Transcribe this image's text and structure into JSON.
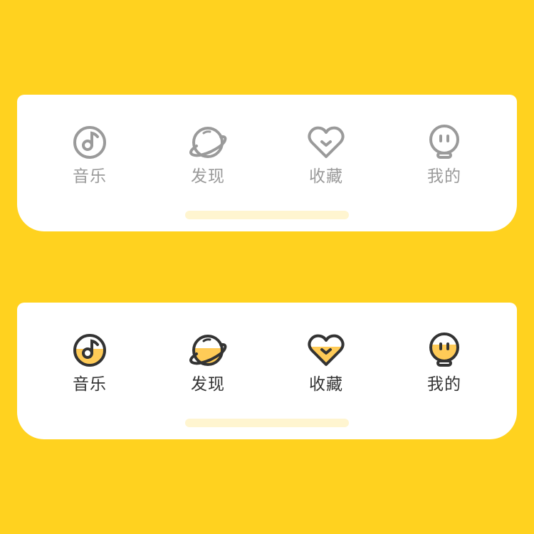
{
  "colors": {
    "background": "#FFD21F",
    "card": "#FFFFFF",
    "inactive_icon": "#9A9A9A",
    "active_stroke": "#333333",
    "active_fill": "#FFCB57",
    "indicator": "#FFF5D0"
  },
  "inactive_bar": {
    "tabs": [
      {
        "label": "音乐",
        "icon": "music-disc-icon"
      },
      {
        "label": "发现",
        "icon": "planet-icon"
      },
      {
        "label": "收藏",
        "icon": "heart-icon"
      },
      {
        "label": "我的",
        "icon": "profile-face-icon"
      }
    ]
  },
  "active_bar": {
    "tabs": [
      {
        "label": "音乐",
        "icon": "music-disc-icon"
      },
      {
        "label": "发现",
        "icon": "planet-icon"
      },
      {
        "label": "收藏",
        "icon": "heart-icon"
      },
      {
        "label": "我的",
        "icon": "profile-face-icon"
      }
    ]
  }
}
